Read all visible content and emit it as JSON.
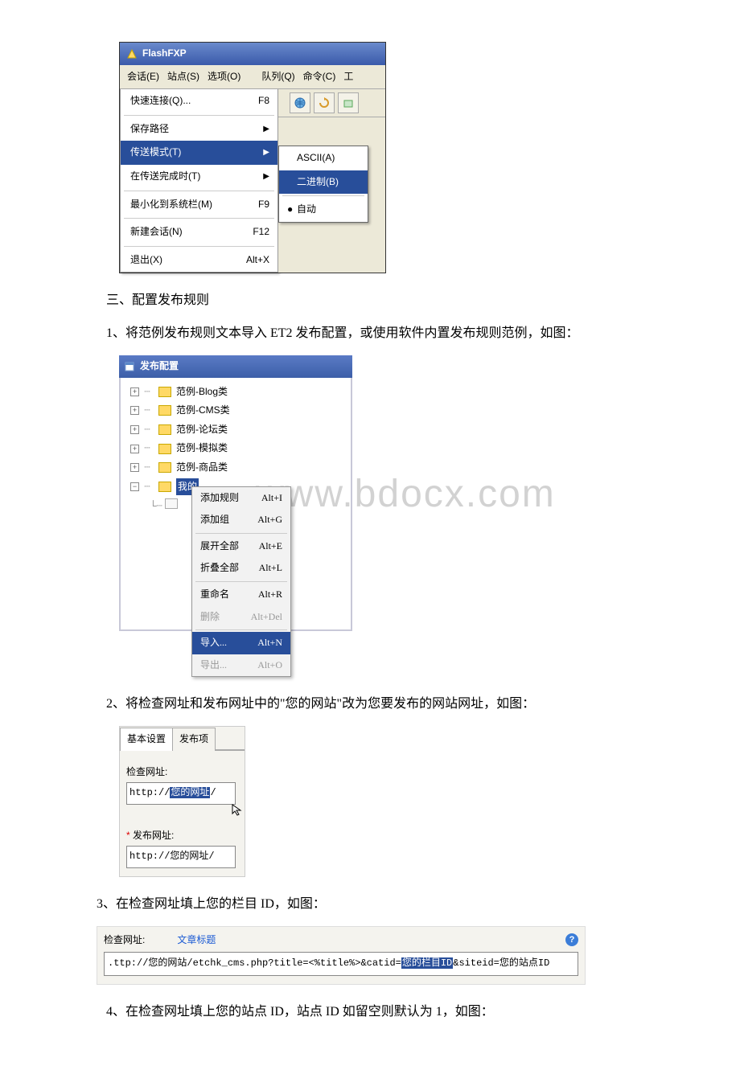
{
  "watermark": "www.bdocx.com",
  "flashfxp": {
    "title": "FlashFXP",
    "menubar": [
      "会话(E)",
      "站点(S)",
      "选项(O)",
      "队列(Q)",
      "命令(C)",
      "工"
    ],
    "menu": {
      "quick_connect": "快速连接(Q)...",
      "quick_connect_kb": "F8",
      "save_path": "保存路径",
      "transfer_mode": "传送模式(T)",
      "on_complete": "在传送完成时(T)",
      "minimize": "最小化到系统栏(M)",
      "minimize_kb": "F9",
      "new_session": "新建会话(N)",
      "new_session_kb": "F12",
      "exit": "退出(X)",
      "exit_kb": "Alt+X"
    },
    "submenu": {
      "ascii": "ASCII(A)",
      "binary": "二进制(B)",
      "auto": "自动"
    }
  },
  "text": {
    "section3": "三、配置发布规则",
    "step1": "1、将范例发布规则文本导入 ET2 发布配置，或使用软件内置发布规则范例，如图：",
    "step2": "2、将检查网址和发布网址中的\"您的网站\"改为您要发布的网站网址，如图：",
    "step3": "3、在检查网址填上您的栏目 ID，如图：",
    "step4": "4、在检查网址填上您的站点 ID，站点 ID 如留空则默认为 1，如图："
  },
  "pubcfg": {
    "title": "发布配置",
    "tree": [
      "范例-Blog类",
      "范例-CMS类",
      "范例-论坛类",
      "范例-模拟类",
      "范例-商品类"
    ],
    "tree_selected": "我的",
    "ctx": {
      "add_rule": "添加规则",
      "add_rule_kb": "Alt+I",
      "add_group": "添加组",
      "add_group_kb": "Alt+G",
      "expand": "展开全部",
      "expand_kb": "Alt+E",
      "collapse": "折叠全部",
      "collapse_kb": "Alt+L",
      "rename": "重命名",
      "rename_kb": "Alt+R",
      "delete": "删除",
      "delete_kb": "Alt+Del",
      "import": "导入...",
      "import_kb": "Alt+N",
      "export": "导出...",
      "export_kb": "Alt+O"
    }
  },
  "urlset": {
    "tab1": "基本设置",
    "tab2": "发布项",
    "check_label": "检查网址:",
    "check_prefix": "http://",
    "check_hl": "您的网址",
    "check_suffix": "/",
    "publish_label": "发布网址:",
    "publish_value": "http://您的网址/"
  },
  "checkurl": {
    "label": "检查网址:",
    "hint": "文章标题",
    "prefix": ".ttp://您的网站/etchk_cms.php?title=<%title%>&catid=",
    "hl": "您的栏目ID",
    "suffix": "&siteid=您的站点ID"
  }
}
